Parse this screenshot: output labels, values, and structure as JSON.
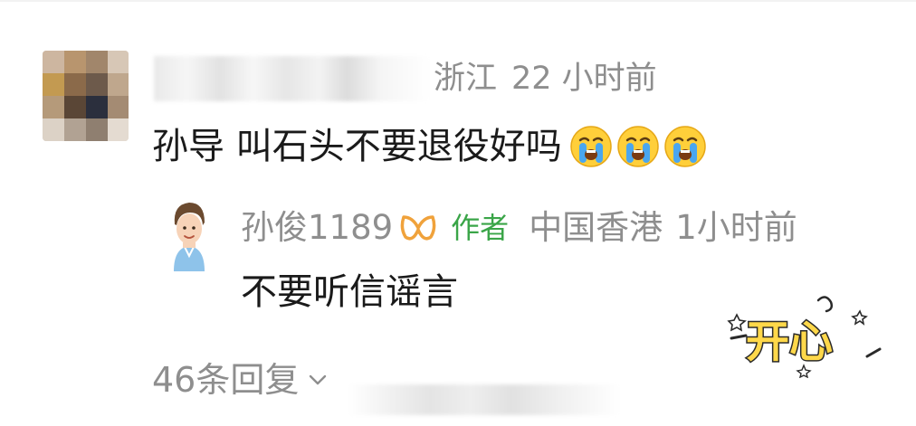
{
  "main_comment": {
    "location": "浙江",
    "time": "22 小时前",
    "text": "孙导 叫石头不要退役好吗",
    "emoji_count": 3,
    "emoji_name": "crying-face"
  },
  "reply": {
    "username": "孙俊1189",
    "author_tag": "作者",
    "location": "中国香港",
    "time": "1小时前",
    "text": "不要听信谣言",
    "badge_color": "#f0a23b"
  },
  "sticker": {
    "text": "开心"
  },
  "footer": {
    "replies_label": "46条回复"
  },
  "colors": {
    "meta": "#8e8e8e",
    "author_tag": "#3aa548",
    "text": "#1a1a1a"
  }
}
